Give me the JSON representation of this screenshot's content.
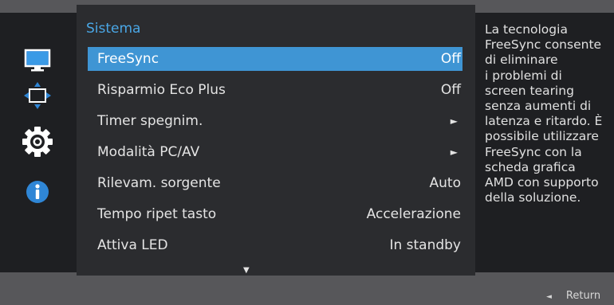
{
  "sidebar": {
    "icons": [
      {
        "name": "picture-icon"
      },
      {
        "name": "onscreen-display-icon"
      },
      {
        "name": "system-gear-icon"
      },
      {
        "name": "information-icon"
      }
    ]
  },
  "menu": {
    "title": "Sistema",
    "items": [
      {
        "label": "FreeSync",
        "value": "Off",
        "selected": true
      },
      {
        "label": "Risparmio Eco Plus",
        "value": "Off"
      },
      {
        "label": "Timer spegnim.",
        "value": "►"
      },
      {
        "label": "Modalità PC/AV",
        "value": "►"
      },
      {
        "label": "Rilevam. sorgente",
        "value": "Auto"
      },
      {
        "label": "Tempo ripet tasto",
        "value": "Accelerazione"
      },
      {
        "label": "Attiva LED",
        "value": "In standby"
      }
    ],
    "more_indicator": "▼"
  },
  "help": {
    "text": "La tecnologia\nFreeSync consente\ndi eliminare\ni problemi di\nscreen tearing\nsenza aumenti di\nlatenza e ritardo. È\npossibile utilizzare\nFreeSync con la\nscheda grafica\nAMD con supporto\ndella soluzione."
  },
  "footer": {
    "return_icon": "◄",
    "return_label": "Return"
  },
  "colors": {
    "accent": "#3f95d4",
    "title": "#4aa7e6"
  }
}
